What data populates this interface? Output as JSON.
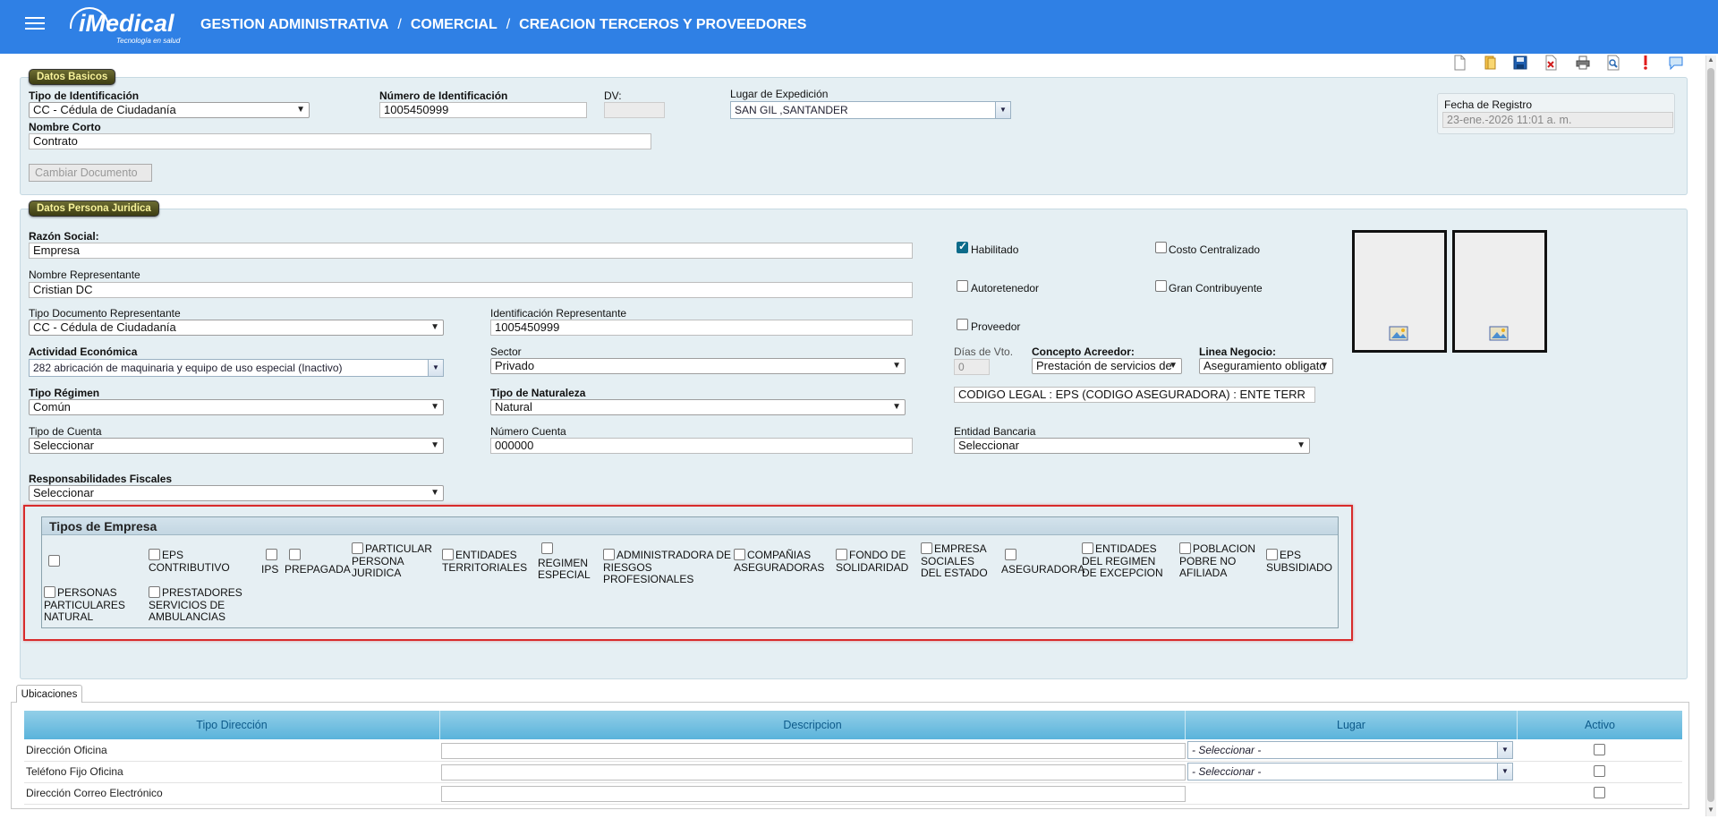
{
  "header": {
    "logo_text": "iMedical",
    "logo_tagline": "Tecnología en salud",
    "breadcrumb": [
      "GESTION ADMINISTRATIVA",
      "COMERCIAL",
      "CREACION TERCEROS Y PROVEEDORES"
    ],
    "separator": "/"
  },
  "toolbar": [
    "new-icon",
    "open-icon",
    "save-icon",
    "delete-icon",
    "print-icon",
    "preview-icon",
    "alert-icon",
    "chat-icon"
  ],
  "datos_basicos": {
    "legend": "Datos Basicos",
    "tipo_identificacion_label": "Tipo de Identificación",
    "tipo_identificacion_value": "CC - Cédula de Ciudadanía",
    "numero_identificacion_label": "Número de Identificación",
    "numero_identificacion_value": "1005450999",
    "dv_label": "DV:",
    "dv_value": "",
    "lugar_expedicion_label": "Lugar de Expedición",
    "lugar_expedicion_value": "SAN GIL ,SANTANDER",
    "nombre_corto_label": "Nombre Corto",
    "nombre_corto_value": "Contrato",
    "cambiar_documento": "Cambiar Documento",
    "fecha_registro_label": "Fecha de Registro",
    "fecha_registro_value": "23-ene.-2026 11:01 a. m."
  },
  "datos_juridica": {
    "legend": "Datos Persona Juridica",
    "razon_social_label": "Razón Social:",
    "razon_social_value": "Empresa",
    "nombre_representante_label": "Nombre Representante",
    "nombre_representante_value": "Cristian DC",
    "tipo_doc_rep_label": "Tipo Documento Representante",
    "tipo_doc_rep_value": "CC - Cédula de Ciudadanía",
    "id_rep_label": "Identificación Representante",
    "id_rep_value": "1005450999",
    "actividad_label": "Actividad Económica",
    "actividad_value": "282  abricación de maquinaria y equipo de uso especial (Inactivo)",
    "sector_label": "Sector",
    "sector_value": "Privado",
    "tipo_regimen_label": "Tipo Régimen",
    "tipo_regimen_value": "Común",
    "tipo_naturaleza_label": "Tipo de Naturaleza",
    "tipo_naturaleza_value": "Natural",
    "tipo_cuenta_label": "Tipo de Cuenta",
    "tipo_cuenta_value": "Seleccionar",
    "numero_cuenta_label": "Número Cuenta",
    "numero_cuenta_value": "000000",
    "entidad_bancaria_label": "Entidad Bancaria",
    "entidad_bancaria_value": "Seleccionar",
    "responsabilidades_label": "Responsabilidades Fiscales",
    "responsabilidades_value": "Seleccionar",
    "habilitado_label": "Habilitado",
    "habilitado_checked": true,
    "costo_centralizado_label": "Costo Centralizado",
    "autoretenedor_label": "Autoretenedor",
    "gran_contribuyente_label": "Gran Contribuyente",
    "proveedor_label": "Proveedor",
    "dias_vto_label": "Días de Vto.",
    "dias_vto_value": "0",
    "concepto_acreedor_label": "Concepto Acreedor:",
    "concepto_acreedor_value": "Prestación de servicios de",
    "linea_negocio_label": "Linea Negocio:",
    "linea_negocio_value": "Aseguramiento obligato",
    "codigo_legal": "CODIGO LEGAL : EPS (CODIGO ASEGURADORA) : ENTE TERR"
  },
  "tipos_empresa": {
    "title": "Tipos de Empresa",
    "items": [
      {
        "label": ""
      },
      {
        "label": "EPS CONTRIBUTIVO"
      },
      {
        "label": "IPS"
      },
      {
        "label": "PREPAGADA"
      },
      {
        "label": "PARTICULAR PERSONA JURIDICA"
      },
      {
        "label": "ENTIDADES TERRITORIALES"
      },
      {
        "label": "REGIMEN ESPECIAL"
      },
      {
        "label": "ADMINISTRADORA DE RIESGOS PROFESIONALES"
      },
      {
        "label": "COMPAÑIAS ASEGURADORAS"
      },
      {
        "label": "FONDO DE SOLIDARIDAD"
      },
      {
        "label": "EMPRESA SOCIALES DEL ESTADO"
      },
      {
        "label": "ASEGURADORA"
      },
      {
        "label": "ENTIDADES DEL REGIMEN DE EXCEPCION"
      },
      {
        "label": "POBLACION POBRE NO AFILIADA"
      },
      {
        "label": "EPS SUBSIDIADO"
      },
      {
        "label": "PERSONAS PARTICULARES NATURAL"
      },
      {
        "label": "PRESTADORES SERVICIOS DE AMBULANCIAS"
      }
    ]
  },
  "ubicaciones": {
    "tab": "Ubicaciones",
    "columns": [
      "Tipo Dirección",
      "Descripcion",
      "Lugar",
      "Activo"
    ],
    "rows": [
      {
        "tipo": "Dirección Oficina",
        "descripcion": "",
        "lugar": "- Seleccionar -"
      },
      {
        "tipo": "Teléfono Fijo Oficina",
        "descripcion": "",
        "lugar": "- Seleccionar -"
      },
      {
        "tipo": "Dirección Correo Electrónico",
        "descripcion": "",
        "lugar": ""
      }
    ]
  }
}
